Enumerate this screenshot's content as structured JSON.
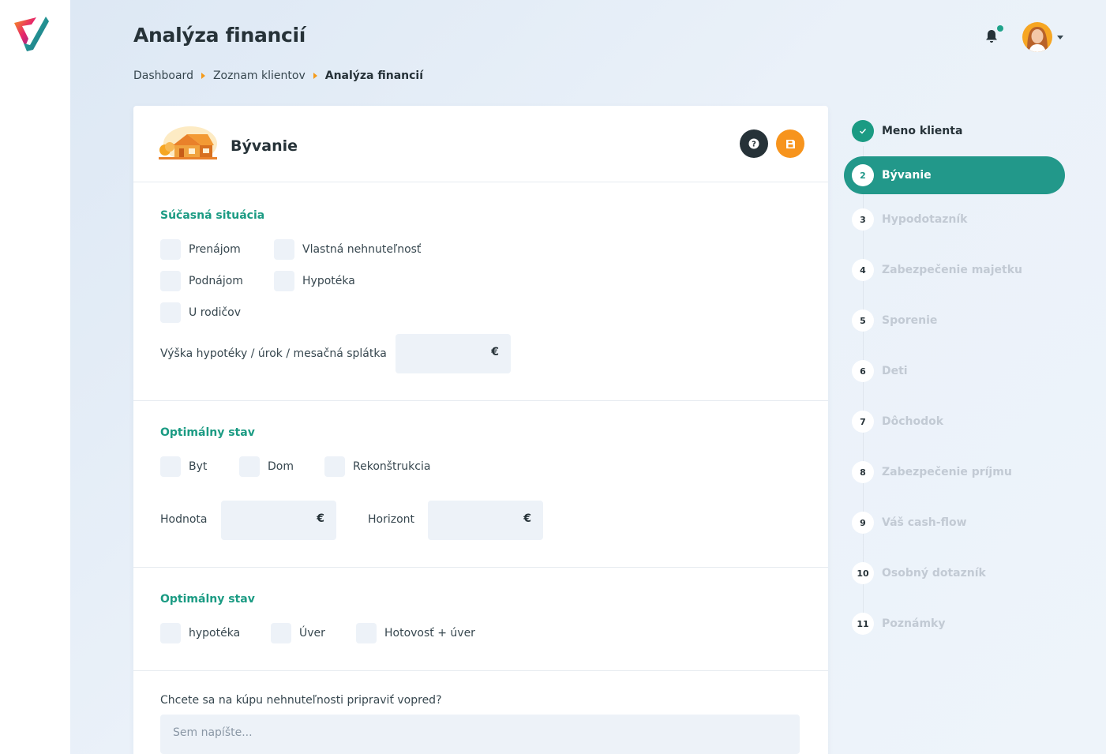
{
  "app": {
    "title": "Analýza financií"
  },
  "breadcrumb": [
    {
      "label": "Dashboard"
    },
    {
      "label": "Zoznam klientov"
    },
    {
      "label": "Analýza financií"
    }
  ],
  "header": {
    "notification_icon": "bell-icon",
    "has_notification": true
  },
  "card": {
    "title": "Bývanie",
    "help_icon": "question-icon",
    "save_icon": "save-icon",
    "sections": {
      "current": {
        "title": "Súčasná situácia",
        "options": [
          "Prenájom",
          "Vlastná nehnuteľnosť",
          "Podnájom",
          "Hypotéka",
          "U rodičov"
        ],
        "mortgage_label": "Výška hypotéky / úrok / mesačná splátka",
        "currency": "€"
      },
      "optimal1": {
        "title": "Optimálny stav",
        "options": [
          "Byt",
          "Dom",
          "Rekonštrukcia"
        ],
        "value_label": "Hodnota",
        "horizon_label": "Horizont",
        "currency": "€"
      },
      "optimal2": {
        "title": "Optimálny stav",
        "options": [
          "hypotéka",
          "Úver",
          "Hotovosť + úver"
        ]
      },
      "question": {
        "label": "Chcete sa na kúpu nehnuteľnosti pripraviť vopred?",
        "placeholder": "Sem napíšte..."
      }
    }
  },
  "stepper": [
    {
      "num": "✓",
      "label": "Meno klienta",
      "state": "done"
    },
    {
      "num": "2",
      "label": "Bývanie",
      "state": "active"
    },
    {
      "num": "3",
      "label": "Hypodotazník",
      "state": "todo"
    },
    {
      "num": "4",
      "label": "Zabezpečenie majetku",
      "state": "todo"
    },
    {
      "num": "5",
      "label": "Sporenie",
      "state": "todo"
    },
    {
      "num": "6",
      "label": "Deti",
      "state": "todo"
    },
    {
      "num": "7",
      "label": "Dôchodok",
      "state": "todo"
    },
    {
      "num": "8",
      "label": "Zabezpečenie príjmu",
      "state": "todo"
    },
    {
      "num": "9",
      "label": "Váš cash-flow",
      "state": "todo"
    },
    {
      "num": "10",
      "label": "Osobný dotazník",
      "state": "todo"
    },
    {
      "num": "11",
      "label": "Poznámky",
      "state": "todo"
    }
  ],
  "colors": {
    "accent": "#22988a",
    "section_title": "#1b9b83",
    "save_button": "#f7941d",
    "help_button": "#263238",
    "input_bg": "#edf2f8"
  }
}
